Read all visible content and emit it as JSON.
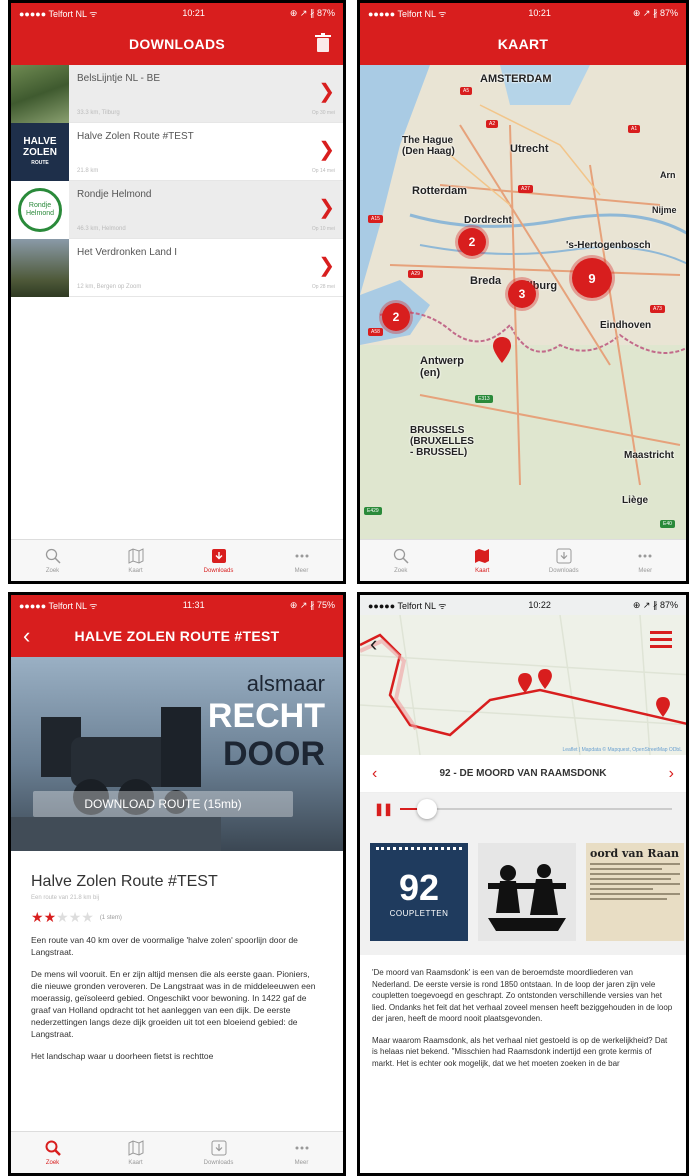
{
  "status": {
    "downloads": {
      "carrier": "●●●●● Telfort NL ᯤ",
      "time": "10:21",
      "battery": "⊕ ↗ ∦ 87%"
    },
    "kaart": {
      "carrier": "●●●●● Telfort NL ᯤ",
      "time": "10:21",
      "battery": "⊕ ↗ ∦ 87%"
    },
    "detail": {
      "carrier": "●●●●● Telfort NL ᯤ",
      "time": "11:31",
      "battery": "⊕ ↗ ∦ 75%"
    },
    "player": {
      "carrier": "●●●●● Telfort NL ᯤ",
      "time": "10:22",
      "battery": "⊕ ↗ ∦ 87%"
    }
  },
  "downloads": {
    "title": "DOWNLOADS",
    "items": [
      {
        "title": "BelsLijntje NL - BE",
        "sub": "33.3 km, Tilburg",
        "date": "Op 30 mei"
      },
      {
        "title": "Halve Zolen Route #TEST",
        "sub": "21.8 km",
        "date": "Op 14 mei"
      },
      {
        "title": "Rondje Helmond",
        "sub": "46.3 km, Helmond",
        "date": "Op 10 mei"
      },
      {
        "title": "Het Verdronken Land I",
        "sub": "12 km, Bergen op Zoom",
        "date": "Op 28 mei"
      }
    ],
    "thumb_text": {
      "halve": "HALVE",
      "zolen": "ZOLEN",
      "route": "ROUTE",
      "rondje": "Rondje",
      "helmond": "Helmond"
    }
  },
  "kaart": {
    "title": "KAART",
    "labels": {
      "amsterdam": "AMSTERDAM",
      "hague": "The Hague\n(Den Haag)",
      "utrecht": "Utrecht",
      "rotterdam": "Rotterdam",
      "dordrecht": "Dordrecht",
      "hertogenbosch": "'s-Hertogenbosch",
      "breda": "Breda",
      "tilburg": "Tilburg",
      "eindhoven": "Eindhoven",
      "antwerp": "Antwerp\n(en)",
      "brussels": "BRUSSELS\n(BRUXELLES\n- BRUSSEL)",
      "maastricht": "Maastricht",
      "liege": "Liège",
      "nijmegen": "Nijme",
      "arnhem": "Arn"
    },
    "clusters": [
      "2",
      "9",
      "3",
      "2"
    ]
  },
  "tabs": {
    "zoek": "Zoek",
    "kaart": "Kaart",
    "downloads": "Downloads",
    "meer": "Meer"
  },
  "detail": {
    "title": "HALVE ZOLEN ROUTE #TEST",
    "hero_line1": "alsmaar",
    "hero_line2": "RECHT",
    "hero_line3": "DOOR",
    "download_button": "DOWNLOAD ROUTE (15mb)",
    "route_title": "Halve Zolen Route #TEST",
    "route_sub": "Een route van 21.8 km bij",
    "rating": 2,
    "rating_count": "(1 stem)",
    "para1": "Een route van 40 km over de voormalige 'halve zolen' spoorlijn door de Langstraat.",
    "para2": "De mens wil vooruit. En er zijn altijd mensen die als eerste gaan. Pioniers, die nieuwe gronden veroveren. De Langstraat was in de middeleeuwen een moerassig, geïsoleerd gebied. Ongeschikt voor bewoning. In 1422 gaf de graaf van Holland opdracht tot het aanleggen van een dijk. De eerste nederzettingen langs deze dijk groeiden uit tot een bloeiend gebied: de Langstraat.",
    "para3": "Het landschap waar u doorheen fietst is rechttoe"
  },
  "player": {
    "map_attribution": "Leaflet | Mapdata © Mapquest, OpenStreetMap ODbL",
    "track_title": "92 - DE MOORD VAN RAAMSDONK",
    "progress": 0.1,
    "tile_number": "92",
    "tile_label": "COUPLETTEN",
    "news_headline": "oord van Raan",
    "text1": "'De moord van Raamsdonk' is een van de beroemdste moordliederen van Nederland. De eerste versie is rond 1850 ontstaan. In de loop der jaren zijn vele coupletten toegevoegd en geschrapt. Zo ontstonden verschillende versies van het lied. Ondanks het feit dat het verhaal zoveel mensen heeft beziggehouden in de loop der jaren, heeft de moord nooit plaatsgevonden.",
    "text2": "Maar waarom Raamsdonk, als het verhaal niet gestoeld is op de werkelijkheid? Dat is helaas niet bekend. \"Misschien had Raamsdonk indertijd een grote kermis of markt. Het is echter ook mogelijk, dat we het moeten zoeken in de bar"
  },
  "colors": {
    "brand": "#d81e1e",
    "tile_navy": "#1f3b5e"
  }
}
